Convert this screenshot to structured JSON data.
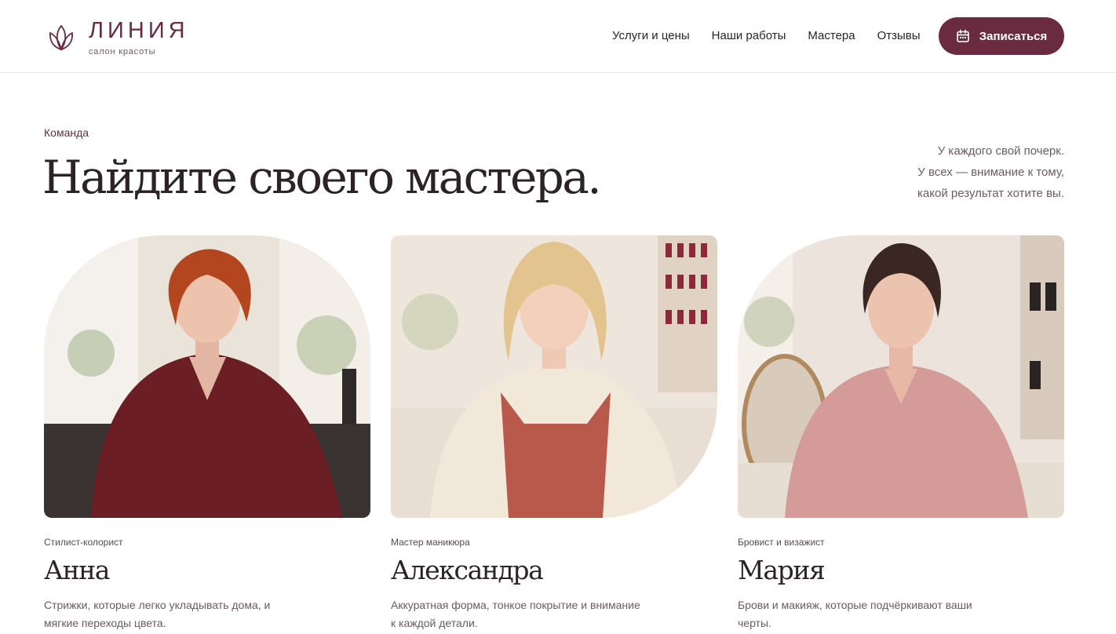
{
  "brand": {
    "name": "ЛИНИЯ",
    "subtitle": "салон красоты",
    "accent": "#6a2a3f"
  },
  "nav": [
    {
      "label": "Услуги и цены"
    },
    {
      "label": "Наши работы"
    },
    {
      "label": "Мастера"
    },
    {
      "label": "Отзывы"
    }
  ],
  "cta": {
    "label": "Записаться",
    "icon": "calendar-icon"
  },
  "section": {
    "eyebrow": "Команда",
    "title": "Найдите своего мастера.",
    "tagline": [
      "У каждого свой почерк.",
      "У всех — внимание к тому,",
      "какой результат хотите вы."
    ]
  },
  "masters": [
    {
      "role": "Стилист-колорист",
      "name": "Анна",
      "description": "Стрижки, которые легко укладывать дома, и мягкие переходы цвета."
    },
    {
      "role": "Мастер маникюра",
      "name": "Александра",
      "description": "Аккуратная форма, тонкое покрытие и внимание к каждой детали."
    },
    {
      "role": "Бровист и визажист",
      "name": "Мария",
      "description": "Брови и макияж, которые подчёркивают ваши черты."
    }
  ]
}
